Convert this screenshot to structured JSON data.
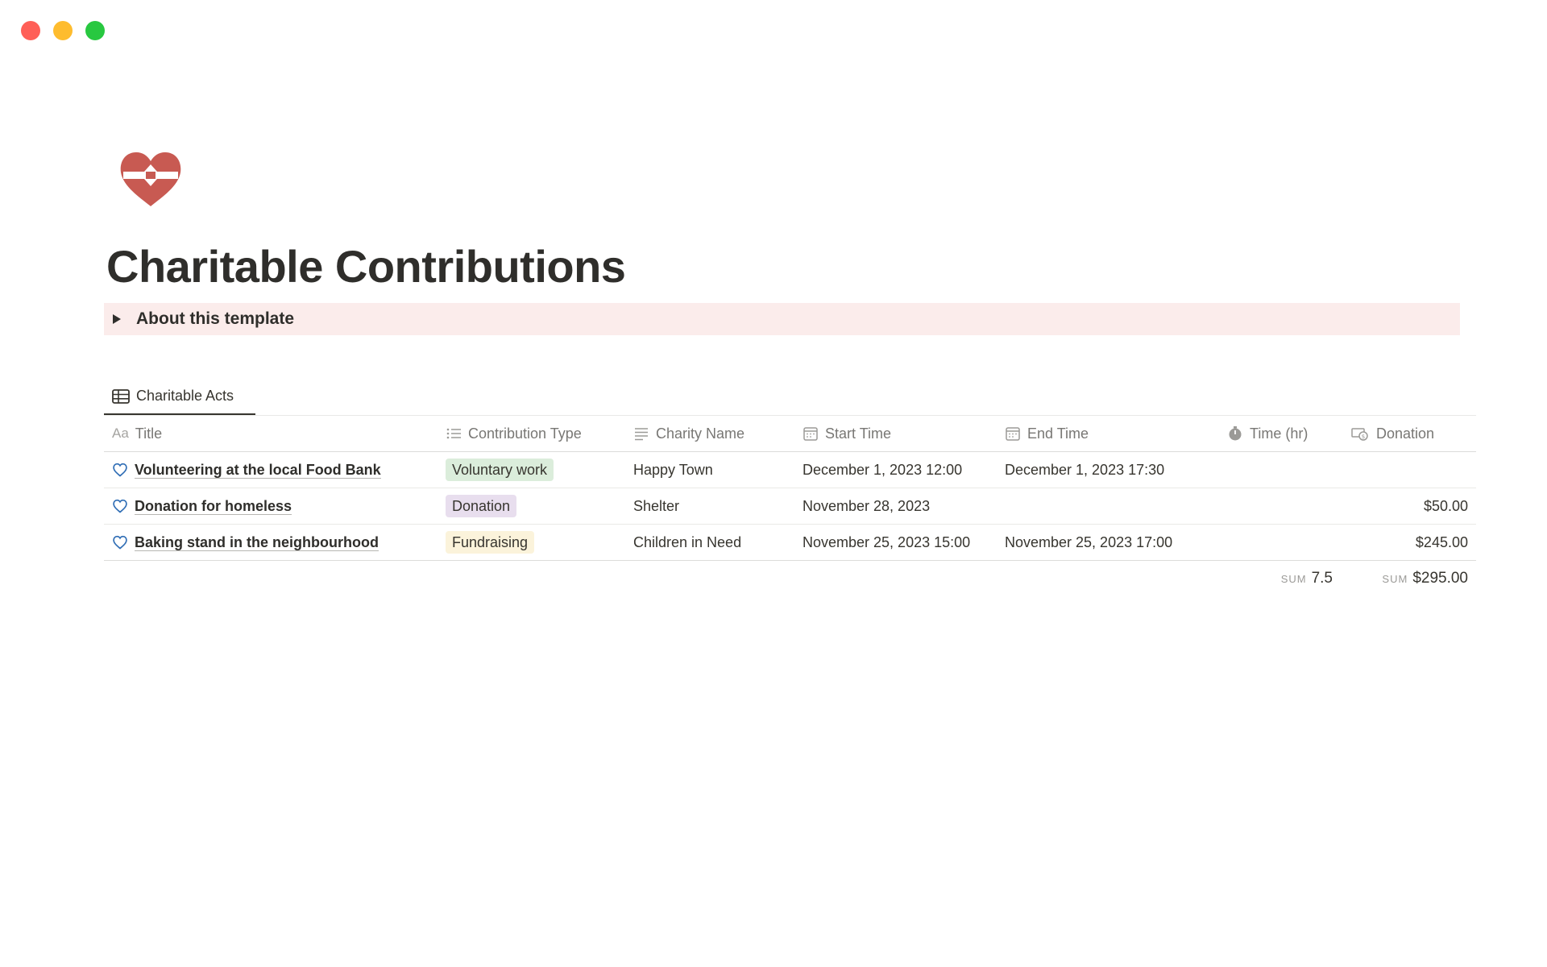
{
  "window": {
    "controls": [
      {
        "name": "close",
        "color": "#ff5f57"
      },
      {
        "name": "minimize",
        "color": "#febc2e"
      },
      {
        "name": "maximize",
        "color": "#28c840"
      }
    ]
  },
  "page": {
    "icon": "heart-bandage-icon",
    "title": "Charitable Contributions",
    "callout_label": "About this template",
    "callout_color": "#fbeceb"
  },
  "database": {
    "tab_label": "Charitable Acts",
    "columns": {
      "title": "Title",
      "title_icon": "Aa",
      "type": "Contribution Type",
      "charity": "Charity Name",
      "start": "Start Time",
      "end": "End Time",
      "time": "Time (hr)",
      "donation": "Donation"
    },
    "rows": [
      {
        "title": "Volunteering at the local Food Bank",
        "type": "Voluntary work",
        "type_bg": "#dbeddb",
        "charity": "Happy Town",
        "start": "December 1, 2023 12:00",
        "end": "December 1, 2023 17:30",
        "time": "",
        "donation": ""
      },
      {
        "title": "Donation for homeless",
        "type": "Donation",
        "type_bg": "#e8deee",
        "charity": "Shelter",
        "start": "November 28, 2023",
        "end": "",
        "time": "",
        "donation": "$50.00"
      },
      {
        "title": "Baking stand in the neighbourhood",
        "type": "Fundraising",
        "type_bg": "#fbf3db",
        "charity": "Children in Need",
        "start": "November 25, 2023 15:00",
        "end": "November 25, 2023 17:00",
        "time": "",
        "donation": "$245.00"
      }
    ],
    "footer": {
      "time_sum_label": "SUM",
      "time_sum": "7.5",
      "donation_sum_label": "SUM",
      "donation_sum": "$295.00"
    }
  }
}
